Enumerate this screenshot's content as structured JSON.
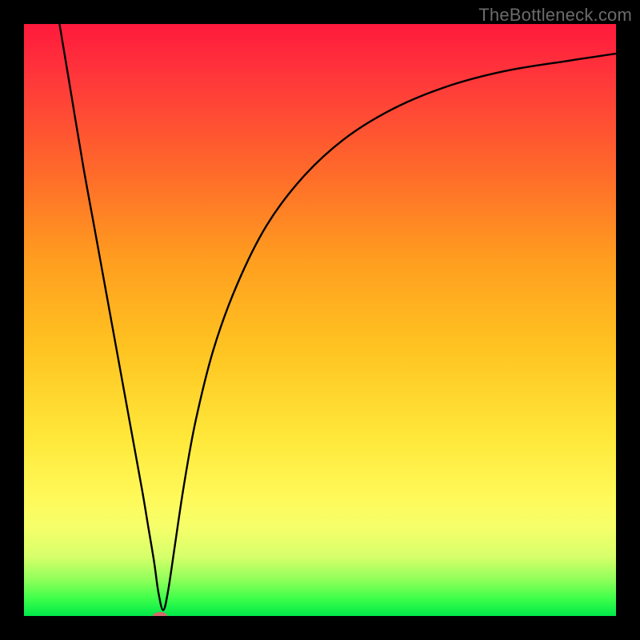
{
  "watermark": "TheBottleneck.com",
  "chart_data": {
    "type": "line",
    "title": "",
    "xlabel": "",
    "ylabel": "",
    "xlim": [
      0,
      100
    ],
    "ylim": [
      0,
      100
    ],
    "grid": false,
    "legend": false,
    "annotations": [
      {
        "type": "marker",
        "x": 23,
        "y": 0,
        "shape": "oval",
        "color": "#d66b6b"
      }
    ],
    "series": [
      {
        "name": "curve",
        "color": "#000000",
        "x": [
          6,
          8,
          10,
          12,
          14,
          16,
          18,
          20,
          21,
          22,
          22.7,
          23.5,
          24.3,
          25.5,
          27,
          29,
          32,
          36,
          41,
          47,
          54,
          62,
          71,
          81,
          92,
          100
        ],
        "y": [
          100,
          88,
          76,
          65,
          54,
          43,
          32,
          21,
          15,
          9,
          4,
          1,
          4,
          12,
          22,
          33,
          45,
          56,
          66,
          74,
          80.5,
          85.5,
          89.3,
          92,
          93.8,
          95
        ]
      }
    ]
  }
}
